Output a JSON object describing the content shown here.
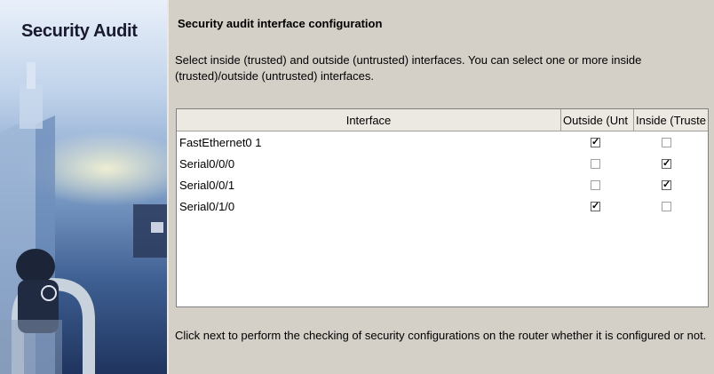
{
  "sidebar": {
    "title": "Security Audit"
  },
  "main": {
    "heading": "Security audit interface configuration",
    "intro": "Select inside (trusted) and outside (untrusted) interfaces. You can select one or more inside (trusted)/outside (untrusted) interfaces.",
    "table": {
      "headers": {
        "interface": "Interface",
        "outside": "Outside (Unt",
        "inside": "Inside (Truste"
      },
      "rows": [
        {
          "name": "FastEthernet0 1",
          "outside": true,
          "inside": false
        },
        {
          "name": "Serial0/0/0",
          "outside": false,
          "inside": true
        },
        {
          "name": "Serial0/0/1",
          "outside": false,
          "inside": true
        },
        {
          "name": "Serial0/1/0",
          "outside": true,
          "inside": false
        }
      ]
    },
    "footer": "Click next to perform the checking of security configurations on the router whether it is configured or not."
  },
  "colors": {
    "window_bg": "#d4d0c8",
    "panel_top": "#e9f0fa",
    "panel_bottom": "#1f345e",
    "header_bg": "#ece9e2"
  },
  "checkmark_glyph": "✓"
}
